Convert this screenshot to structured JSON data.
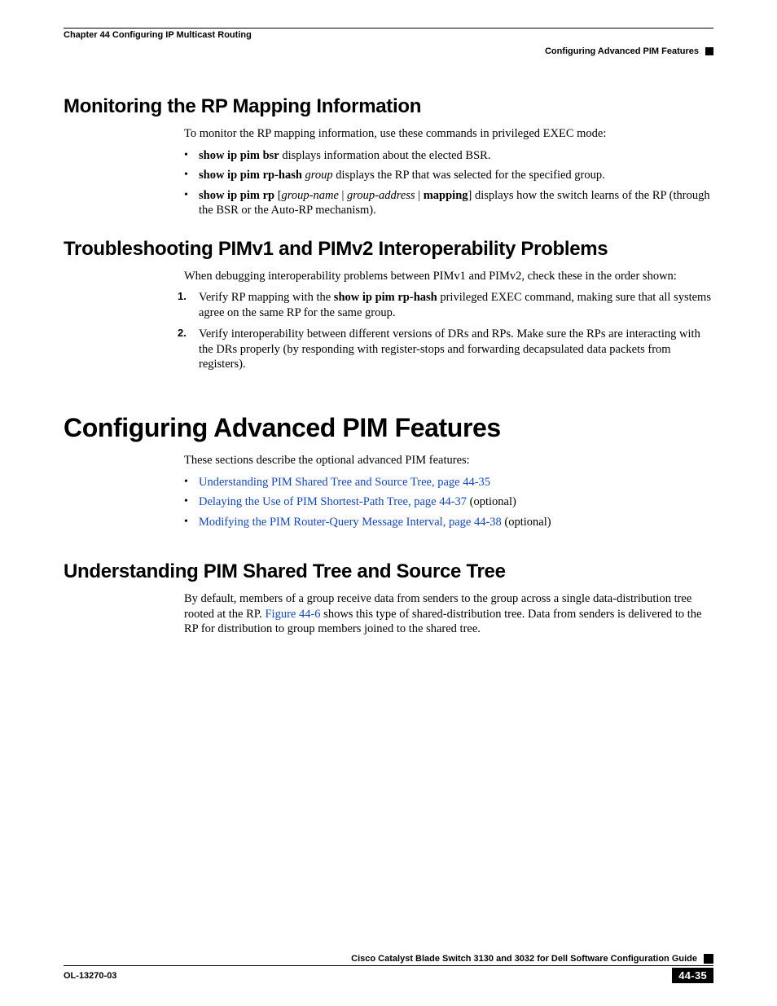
{
  "header": {
    "chapter": "Chapter 44    Configuring IP Multicast Routing",
    "section": "Configuring Advanced PIM Features"
  },
  "s1": {
    "title": "Monitoring the RP Mapping Information",
    "intro": "To monitor the RP mapping information, use these commands in privileged EXEC mode:",
    "b1_cmd": "show ip pim bsr",
    "b1_rest": " displays information about the elected BSR.",
    "b2_cmd": "show ip pim rp-hash",
    "b2_arg": " group",
    "b2_rest": " displays the RP that was selected for the specified group.",
    "b3_cmd": "show ip pim rp",
    "b3_lb": " [",
    "b3_a1": "group-name",
    "b3_pipe1": " | ",
    "b3_a2": "group-address",
    "b3_pipe2": " | ",
    "b3_map": "mapping",
    "b3_rb": "]",
    "b3_rest": " displays how the switch learns of the RP (through the BSR or the Auto-RP mechanism)."
  },
  "s2": {
    "title": "Troubleshooting PIMv1 and PIMv2 Interoperability Problems",
    "intro": "When debugging interoperability problems between PIMv1 and PIMv2, check these in the order shown:",
    "n1_pre": "Verify RP mapping with the ",
    "n1_cmd": "show ip pim rp-hash",
    "n1_post": " privileged EXEC command, making sure that all systems agree on the same RP for the same group.",
    "n2": "Verify interoperability between different versions of DRs and RPs. Make sure the RPs are interacting with the DRs properly (by responding with register-stops and forwarding decapsulated data packets from registers).",
    "num1": "1.",
    "num2": "2."
  },
  "s3": {
    "title": "Configuring Advanced PIM Features",
    "intro": "These sections describe the optional advanced PIM features:",
    "l1": "Understanding PIM Shared Tree and Source Tree, page 44-35",
    "l2": "Delaying the Use of PIM Shortest-Path Tree, page 44-37",
    "l2_suffix": " (optional)",
    "l3": "Modifying the PIM Router-Query Message Interval, page 44-38",
    "l3_suffix": " (optional)"
  },
  "s4": {
    "title": "Understanding PIM Shared Tree and Source Tree",
    "p_pre": "By default, members of a group receive data from senders to the group across a single data-distribution tree rooted at the RP. ",
    "p_link": "Figure 44-6",
    "p_post": " shows this type of shared-distribution tree. Data from senders is delivered to the RP for distribution to group members joined to the shared tree."
  },
  "footer": {
    "pub": "Cisco Catalyst Blade Switch 3130 and 3032 for Dell Software Configuration Guide",
    "doc": "OL-13270-03",
    "page": "44-35"
  }
}
